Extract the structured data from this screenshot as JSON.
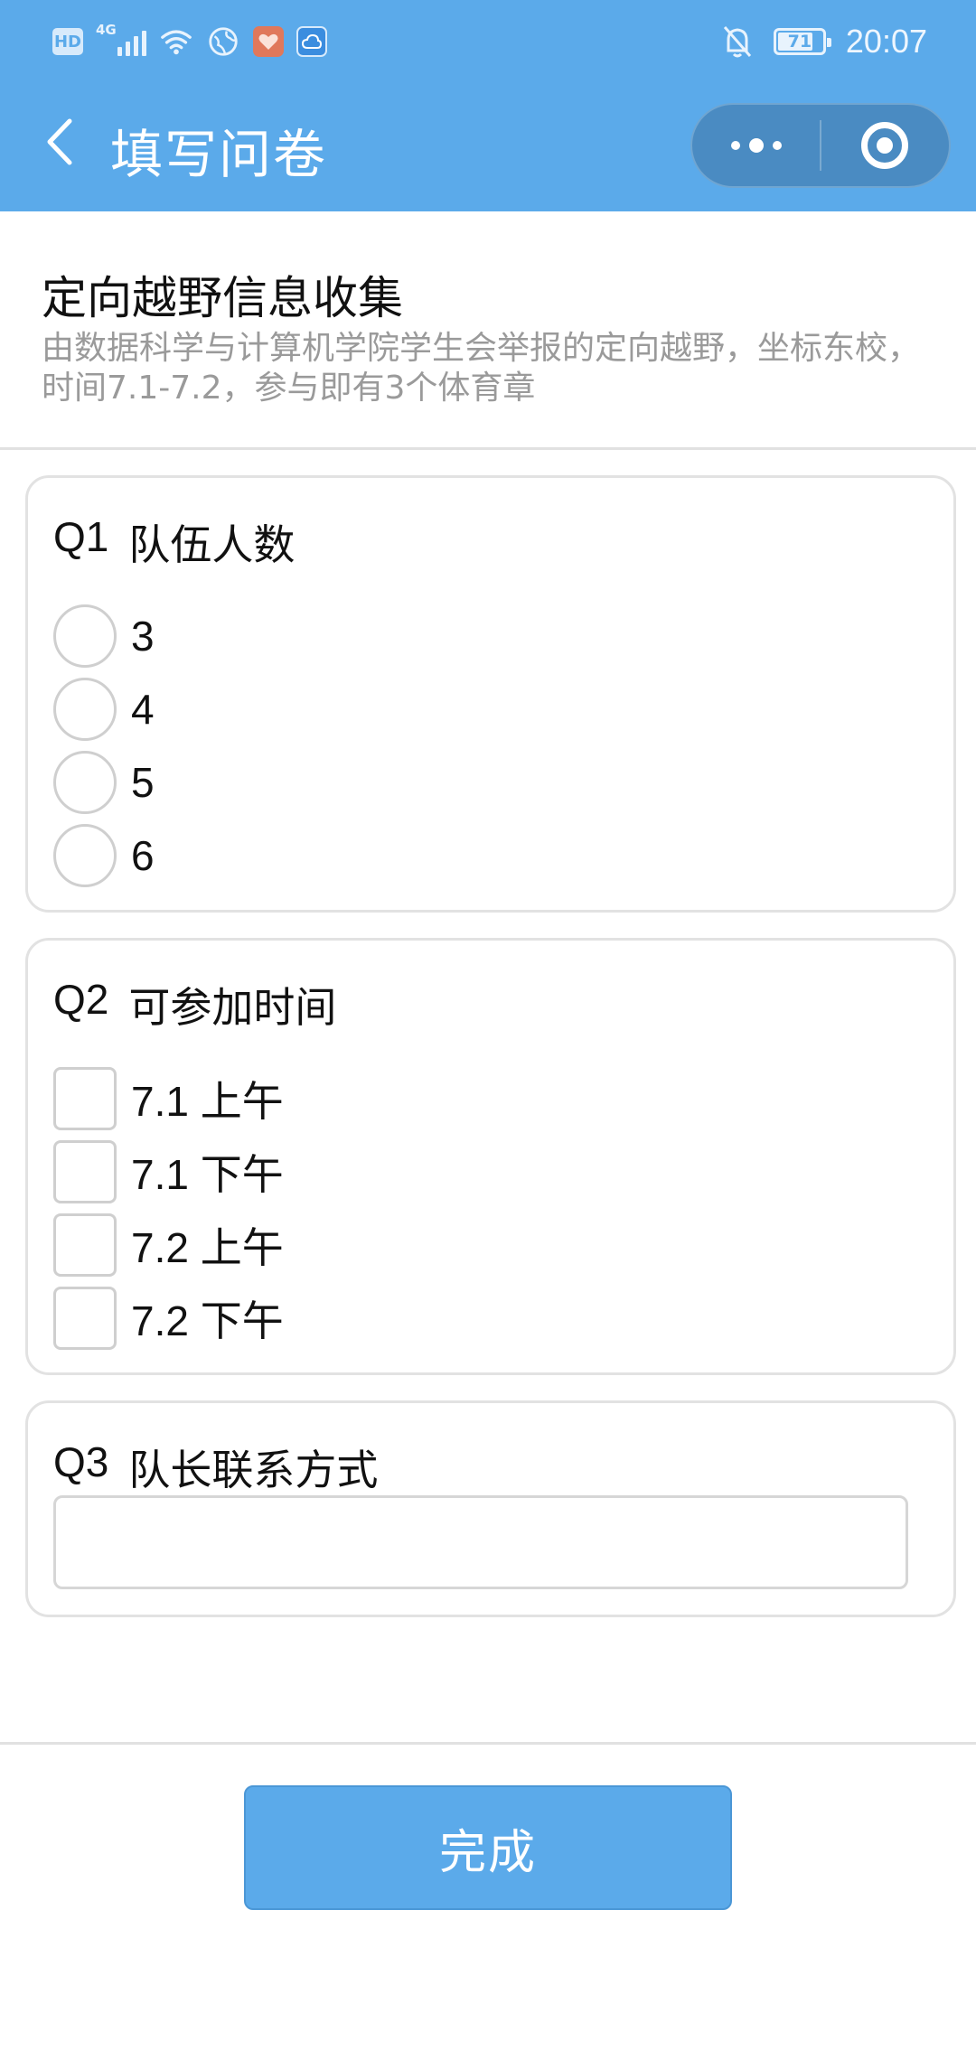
{
  "status_bar": {
    "hd_label": "HD",
    "network_label": "4G",
    "battery": "71",
    "time": "20:07",
    "icons": [
      "hd-icon",
      "signal-icon",
      "wifi-icon",
      "globe-icon",
      "health-app-icon",
      "cloud-app-icon",
      "mute-bell-icon",
      "battery-icon"
    ]
  },
  "nav": {
    "title": "填写问卷",
    "icons": [
      "back-arrow-icon",
      "more-dots-icon",
      "close-target-icon"
    ]
  },
  "survey": {
    "title": "定向越野信息收集",
    "description": "由数据科学与计算机学院学生会举报的定向越野，坐标东校，时间7.1-7.2，参与即有3个体育章"
  },
  "questions": [
    {
      "number": "Q1",
      "title": "队伍人数",
      "type": "radio",
      "options": [
        "3",
        "4",
        "5",
        "6"
      ]
    },
    {
      "number": "Q2",
      "title": "可参加时间",
      "type": "checkbox",
      "options": [
        "7.1 上午",
        "7.1 下午",
        "7.2 上午",
        "7.2 下午"
      ]
    },
    {
      "number": "Q3",
      "title": "队长联系方式",
      "type": "text",
      "value": "",
      "placeholder": ""
    }
  ],
  "submit_label": "完成",
  "colors": {
    "primary": "#5baaea",
    "capsule": "#4a8bc2",
    "border": "#e2e2e2",
    "muted_text": "#9a9a9a"
  }
}
